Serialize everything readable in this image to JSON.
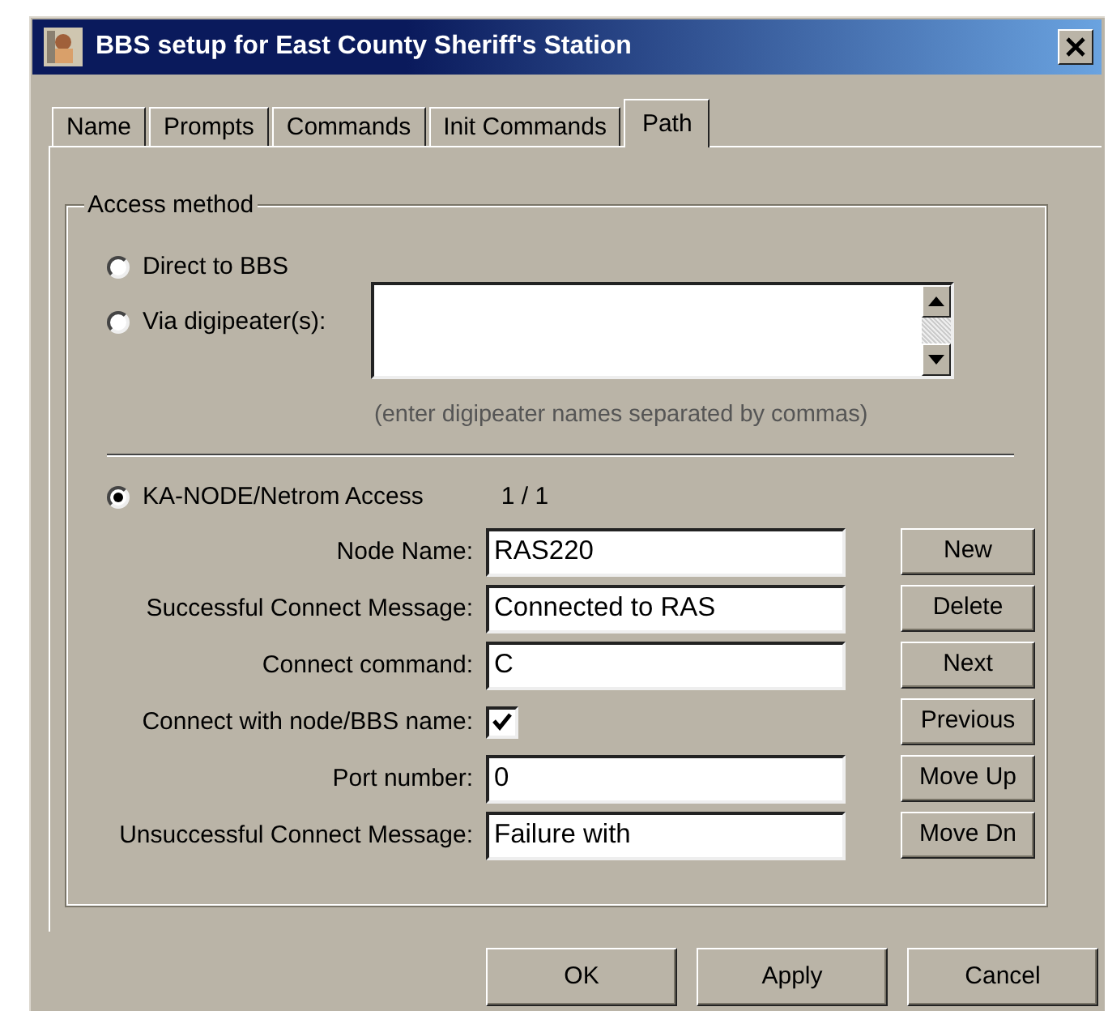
{
  "window": {
    "title": "BBS setup for East County Sheriff's Station"
  },
  "tabs": [
    {
      "label": "Name",
      "selected": false
    },
    {
      "label": "Prompts",
      "selected": false
    },
    {
      "label": "Commands",
      "selected": false
    },
    {
      "label": "Init Commands",
      "selected": false
    },
    {
      "label": "Path",
      "selected": true
    }
  ],
  "access_method": {
    "title": "Access method",
    "options": [
      {
        "kind": "plain",
        "label": "Direct to BBS",
        "selected": false
      },
      {
        "kind": "digipeater",
        "label": "Via digipeater(s):",
        "selected": false
      },
      {
        "kind": "node",
        "label": "KA-NODE/Netrom Access",
        "selected": true
      }
    ],
    "digipeater_hint": "(enter digipeater names separated by commas)",
    "record_counter": "1 / 1",
    "fields": [
      {
        "kind": "text",
        "label": "Node Name:",
        "value": "RAS220"
      },
      {
        "kind": "text",
        "label": "Successful Connect Message:",
        "value": "Connected to RAS"
      },
      {
        "kind": "text",
        "label": "Connect command:",
        "value": "C"
      },
      {
        "kind": "checkbox",
        "label": "Connect with node/BBS name:",
        "checked": true
      },
      {
        "kind": "text",
        "label": "Port number:",
        "value": "0"
      },
      {
        "kind": "text",
        "label": "Unsuccessful Connect Message:",
        "value": "Failure with"
      }
    ],
    "side_buttons": [
      "New",
      "Delete",
      "Next",
      "Previous",
      "Move Up",
      "Move Dn"
    ]
  },
  "buttons": [
    "OK",
    "Apply",
    "Cancel"
  ]
}
